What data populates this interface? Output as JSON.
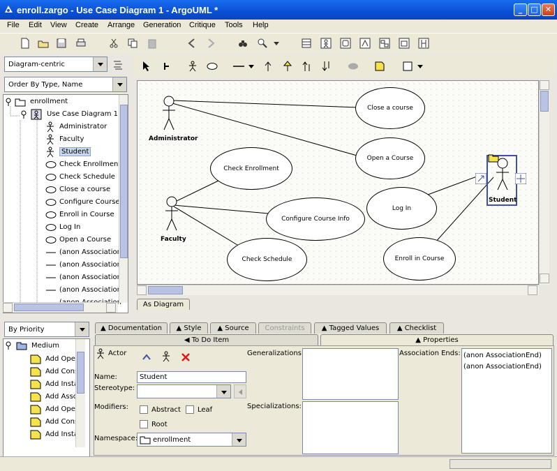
{
  "window": {
    "title": "enroll.zargo - Use Case Diagram 1 - ArgoUML *"
  },
  "menu": [
    "File",
    "Edit",
    "View",
    "Create",
    "Arrange",
    "Generation",
    "Critique",
    "Tools",
    "Help"
  ],
  "left": {
    "perspective": "Diagram-centric",
    "order": "Order By Type, Name",
    "tree": {
      "root": "enrollment",
      "diagram": "Use Case Diagram 1",
      "actors": [
        "Administrator",
        "Faculty",
        "Student"
      ],
      "usecases": [
        "Check Enrollment",
        "Check Schedule",
        "Close a course",
        "Configure Course",
        "Enroll in Course",
        "Log In",
        "Open a Course"
      ],
      "associations": [
        "(anon Association",
        "(anon Association",
        "(anon Association",
        "(anon Association",
        "(anon Association"
      ]
    }
  },
  "diagram": {
    "actors": {
      "administrator": "Administrator",
      "faculty": "Faculty",
      "student": "Student"
    },
    "usecases": {
      "close": "Close a course",
      "open": "Open a Course",
      "check_enrollment": "Check Enrollment",
      "configure": "Configure Course Info",
      "check_schedule": "Check Schedule",
      "login": "Log In",
      "enroll": "Enroll in Course"
    },
    "tab": "As Diagram"
  },
  "todo": {
    "mode": "By Priority",
    "group": "Medium",
    "items": [
      "Add Ope",
      "Add Cons",
      "Add Insta",
      "Add Asso",
      "Add Ope",
      "Add Cons",
      "Add Insta"
    ]
  },
  "tabs": {
    "top": [
      "Documentation",
      "Style",
      "Source",
      "Constraints",
      "Tagged Values",
      "Checklist"
    ],
    "todo_item": "To Do Item",
    "properties": "Properties"
  },
  "props": {
    "type": "Actor",
    "name_label": "Name:",
    "name_value": "Student",
    "stereotype_label": "Stereotype:",
    "modifiers_label": "Modifiers:",
    "abstract": "Abstract",
    "leaf": "Leaf",
    "root": "Root",
    "namespace_label": "Namespace:",
    "namespace_value": "enrollment",
    "generalizations_label": "Generalizations:",
    "specializations_label": "Specializations:",
    "association_ends_label": "Association Ends:",
    "association_ends": [
      "(anon AssociationEnd)",
      "(anon AssociationEnd)"
    ]
  }
}
